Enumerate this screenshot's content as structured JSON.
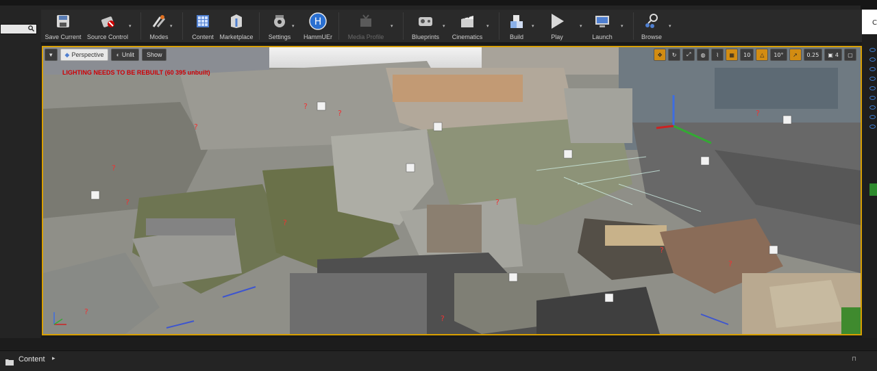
{
  "toolbar": {
    "items": [
      {
        "label": "Save Current",
        "icon": "save-icon"
      },
      {
        "label": "Source Control",
        "icon": "source-control-icon"
      },
      {
        "label": "Modes",
        "icon": "modes-icon"
      },
      {
        "label": "Content",
        "icon": "content-icon"
      },
      {
        "label": "Marketplace",
        "icon": "marketplace-icon"
      },
      {
        "label": "Settings",
        "icon": "settings-icon"
      },
      {
        "label": "HammUEr",
        "icon": "hammuer-icon"
      },
      {
        "label": "Media Profile",
        "icon": "media-profile-icon"
      },
      {
        "label": "Blueprints",
        "icon": "blueprints-icon"
      },
      {
        "label": "Cinematics",
        "icon": "cinematics-icon"
      },
      {
        "label": "Build",
        "icon": "build-icon"
      },
      {
        "label": "Play",
        "icon": "play-icon"
      },
      {
        "label": "Launch",
        "icon": "launch-icon"
      },
      {
        "label": "Browse",
        "icon": "browse-icon"
      }
    ]
  },
  "viewport": {
    "perspective_label": "Perspective",
    "unlit_label": "Unlit",
    "show_label": "Show",
    "warning": "LIGHTING NEEDS TO BE REBUILT (60 395 unbuilt)",
    "grid_snap": "10",
    "rotation_snap": "10°",
    "scale_snap": "0.25",
    "camera_speed": "4",
    "accent_color": "#d9a000"
  },
  "bottom": {
    "content_label": "Content"
  },
  "window": {
    "corner_text": "C"
  }
}
